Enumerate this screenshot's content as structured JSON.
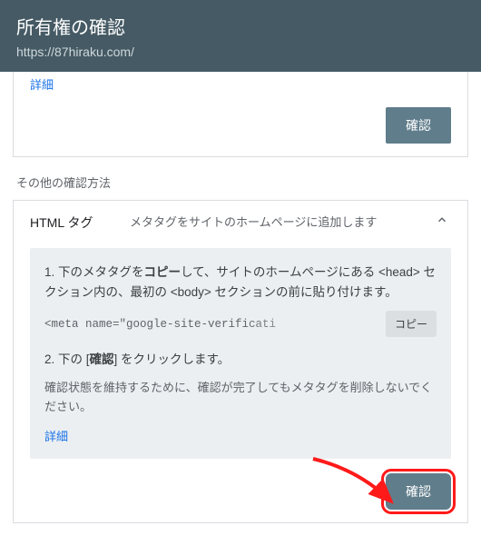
{
  "header": {
    "title": "所有権の確認",
    "url": "https://87hiraku.com/"
  },
  "card1": {
    "details": "詳細",
    "confirm": "確認"
  },
  "other_methods_label": "その他の確認方法",
  "html_tag_section": {
    "title": "HTML タグ",
    "desc": "メタタグをサイトのホームページに追加します",
    "step1_prefix": "1. 下のメタタグを",
    "step1_bold": "コピー",
    "step1_suffix": "して、サイトのホームページにある <head> セクション内の、最初の <body> セクションの前に貼り付けます。",
    "meta_code": "<meta name=\"google-site-verificati",
    "copy_label": "コピー",
    "step2_prefix": "2. 下の [",
    "step2_bold": "確認",
    "step2_suffix": "] をクリックします。",
    "note": "確認状態を維持するために、確認が完了してもメタタグを削除しないでください。",
    "details": "詳細",
    "confirm": "確認"
  }
}
